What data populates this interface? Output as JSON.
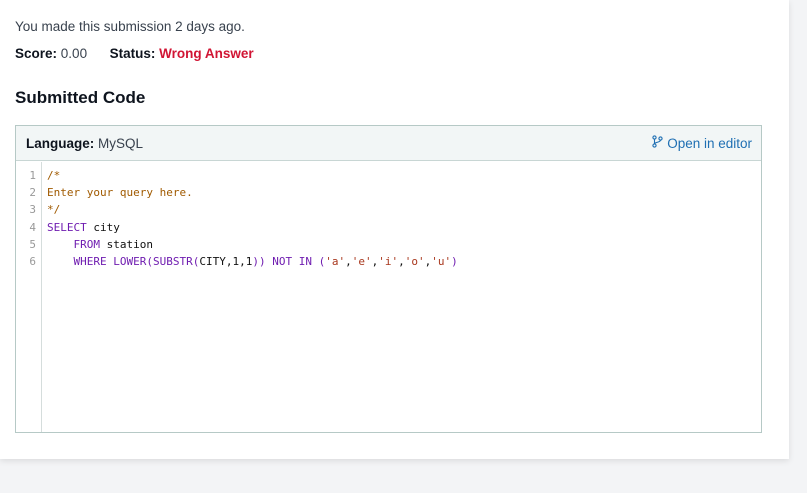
{
  "submission": {
    "meta": "You made this submission 2 days ago.",
    "score_label": "Score:",
    "score_value": "0.00",
    "status_label": "Status:",
    "status_value": "Wrong Answer"
  },
  "section_title": "Submitted Code",
  "code_panel": {
    "language_label": "Language:",
    "language_value": "MySQL",
    "open_editor_label": "Open in editor",
    "line_numbers": [
      "1",
      "2",
      "3",
      "4",
      "5",
      "6"
    ],
    "lines": [
      [
        {
          "t": "/*",
          "c": "comment"
        }
      ],
      [
        {
          "t": "Enter your query here.",
          "c": "comment"
        }
      ],
      [
        {
          "t": "*/",
          "c": "comment"
        }
      ],
      [
        {
          "t": "SELECT",
          "c": "kw"
        },
        {
          "t": " city",
          "c": "plain"
        }
      ],
      [
        {
          "t": "    ",
          "c": "plain"
        },
        {
          "t": "FROM",
          "c": "kw"
        },
        {
          "t": " station",
          "c": "plain"
        }
      ],
      [
        {
          "t": "    ",
          "c": "plain"
        },
        {
          "t": "WHERE",
          "c": "kw"
        },
        {
          "t": " ",
          "c": "plain"
        },
        {
          "t": "LOWER",
          "c": "kw"
        },
        {
          "t": "(",
          "c": "kw"
        },
        {
          "t": "SUBSTR",
          "c": "kw"
        },
        {
          "t": "(",
          "c": "kw"
        },
        {
          "t": "CITY,1,1",
          "c": "plain"
        },
        {
          "t": "))",
          "c": "kw"
        },
        {
          "t": " ",
          "c": "plain"
        },
        {
          "t": "NOT IN",
          "c": "kw"
        },
        {
          "t": " ",
          "c": "plain"
        },
        {
          "t": "(",
          "c": "kw"
        },
        {
          "t": "'a'",
          "c": "str"
        },
        {
          "t": ",",
          "c": "plain"
        },
        {
          "t": "'e'",
          "c": "str"
        },
        {
          "t": ",",
          "c": "plain"
        },
        {
          "t": "'i'",
          "c": "str"
        },
        {
          "t": ",",
          "c": "plain"
        },
        {
          "t": "'o'",
          "c": "str"
        },
        {
          "t": ",",
          "c": "plain"
        },
        {
          "t": "'u'",
          "c": "str"
        },
        {
          "t": ")",
          "c": "kw"
        }
      ]
    ]
  },
  "colors": {
    "status_wrong": "#d11534",
    "link": "#1f6fb3",
    "keyword": "#6f1cb0",
    "comment": "#a05a00",
    "string": "#a8371d"
  },
  "icons": {
    "open_editor": "branch-icon"
  }
}
